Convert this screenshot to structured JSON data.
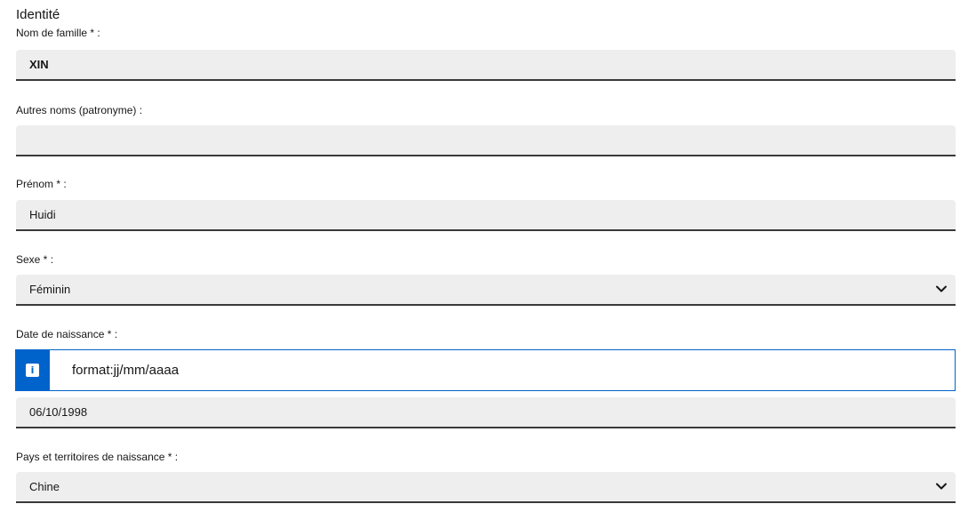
{
  "section": {
    "title": "Identité"
  },
  "fields": {
    "last_name": {
      "label": "Nom de famille * :",
      "value": "XIN"
    },
    "other_names": {
      "label": "Autres noms (patronyme) :",
      "value": ""
    },
    "first_name": {
      "label": "Prénom * :",
      "value": "Huidi"
    },
    "sex": {
      "label": "Sexe * :",
      "value": "Féminin"
    },
    "birth_date": {
      "label": "Date de naissance * :",
      "hint": "format:jj/mm/aaaa",
      "value": "06/10/1998"
    },
    "birth_country": {
      "label": "Pays et territoires de naissance * :",
      "value": "Chine"
    }
  },
  "icons": {
    "info": "info-icon",
    "dropdown": "chevron-down-icon"
  },
  "colors": {
    "accent": "#0063cb",
    "field_bg": "#eeeeee",
    "field_border": "#3a3a3a"
  }
}
